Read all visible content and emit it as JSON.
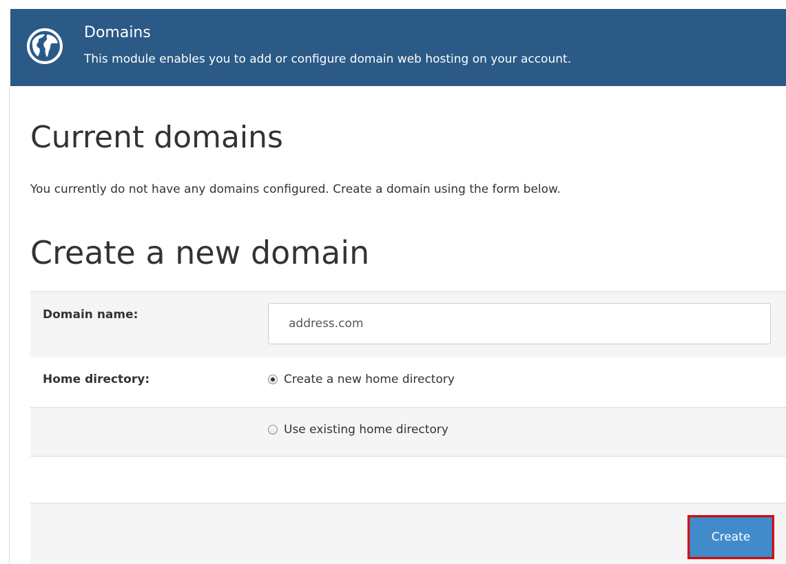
{
  "module": {
    "icon": "globe-icon",
    "title": "Domains",
    "description": "This module enables you to add or configure domain web hosting on your account.",
    "header_color": "#2b5a86"
  },
  "current_domains": {
    "heading": "Current domains",
    "empty_message": "You currently do not have any domains configured. Create a domain using the form below."
  },
  "create_form": {
    "heading": "Create a new domain",
    "domain_name": {
      "label": "Domain name:",
      "placeholder": "address.com",
      "value": ""
    },
    "home_directory": {
      "label": "Home directory:",
      "options": [
        {
          "label": "Create a new home directory",
          "selected": true
        },
        {
          "label": "Use existing home directory",
          "selected": false
        }
      ]
    },
    "submit_label": "Create",
    "accent_color": "#428bca"
  }
}
